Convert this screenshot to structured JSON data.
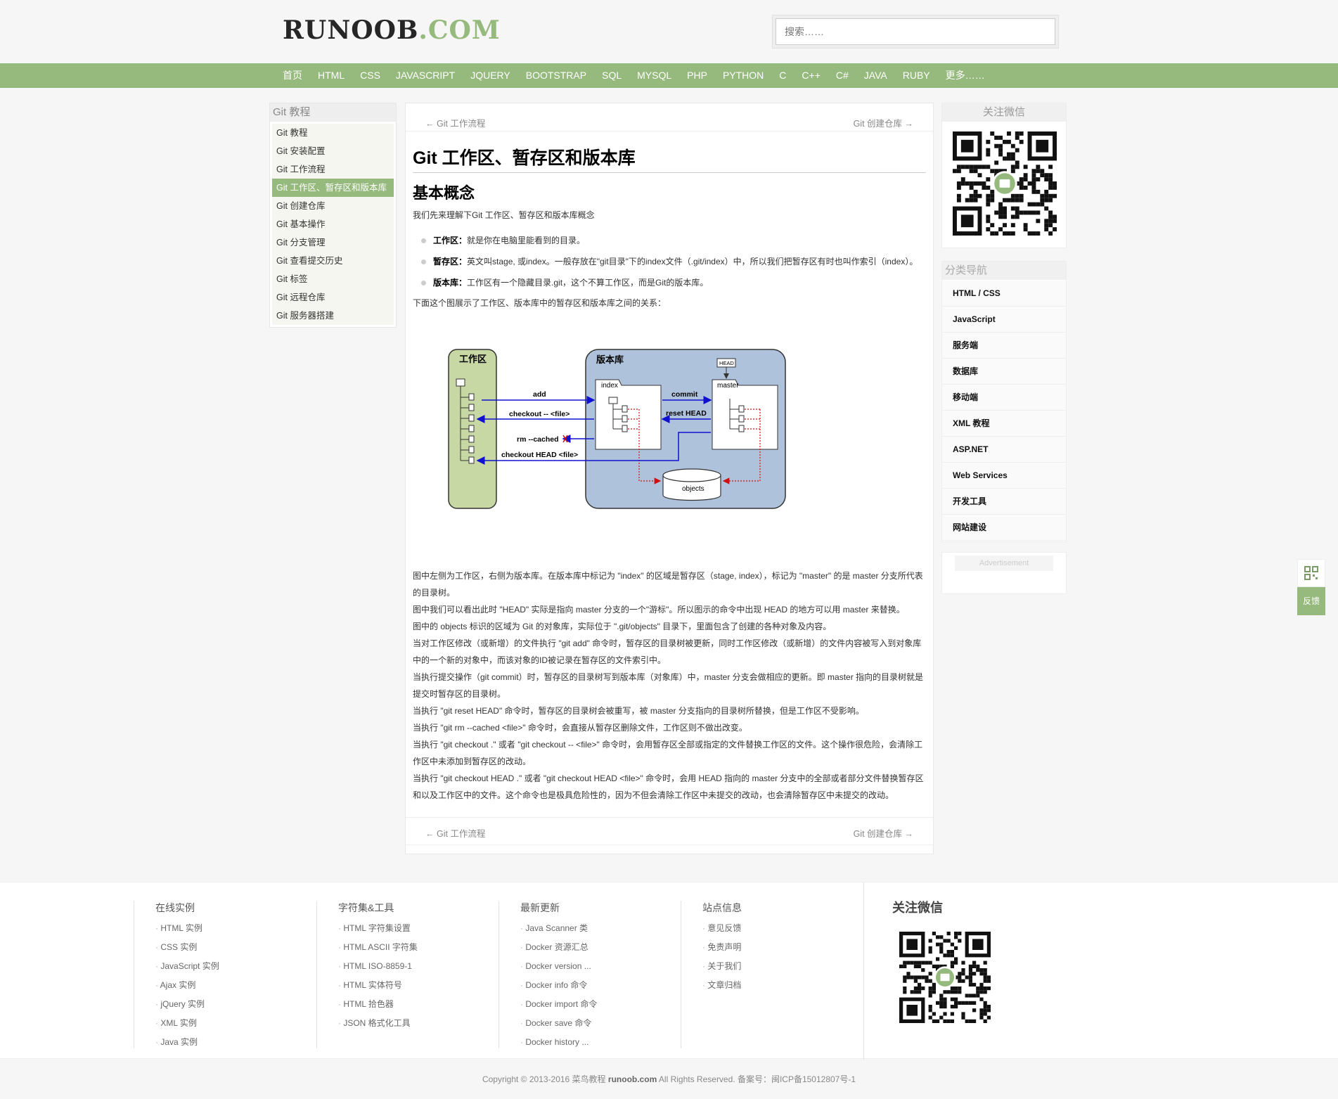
{
  "header": {
    "logo_main": "RUNOOB",
    "logo_dot": ".COM",
    "search_placeholder": "搜索……"
  },
  "nav": [
    "首页",
    "HTML",
    "CSS",
    "JAVASCRIPT",
    "JQUERY",
    "BOOTSTRAP",
    "SQL",
    "MYSQL",
    "PHP",
    "PYTHON",
    "C",
    "C++",
    "C#",
    "JAVA",
    "RUBY",
    "更多……"
  ],
  "left": {
    "title": "Git 教程",
    "items": [
      "Git 教程",
      "Git 安装配置",
      "Git 工作流程",
      "Git 工作区、暂存区和版本库",
      "Git 创建仓库",
      "Git 基本操作",
      "Git 分支管理",
      "Git 查看提交历史",
      "Git 标签",
      "Git 远程仓库",
      "Git 服务器搭建"
    ]
  },
  "main": {
    "prev": "← Git 工作流程",
    "next": "Git 创建仓库 →",
    "title": "Git 工作区、暂存区和版本库",
    "subtitle": "基本概念",
    "intro": "我们先来理解下Git 工作区、暂存区和版本库概念",
    "bullets": [
      {
        "term": "工作区：",
        "text": "就是你在电脑里能看到的目录。"
      },
      {
        "term": "暂存区：",
        "text": "英文叫stage, 或index。一般存放在\"git目录\"下的index文件（.git/index）中，所以我们把暂存区有时也叫作索引（index）。"
      },
      {
        "term": "版本库：",
        "text": "工作区有一个隐藏目录.git，这个不算工作区，而是Git的版本库。"
      }
    ],
    "diagram_desc": "下面这个图展示了工作区、版本库中的暂存区和版本库之间的关系：",
    "diagram": {
      "workspace": "工作区",
      "repo": "版本库",
      "index": "index",
      "master": "master",
      "head": "HEAD",
      "objects": "objects",
      "add": "add",
      "commit": "commit",
      "checkout_file": "checkout -- <file>",
      "reset_head": "reset HEAD",
      "rm_cached": "rm --cached",
      "checkout_head": "checkout HEAD <file>"
    },
    "paragraphs": [
      "图中左侧为工作区，右侧为版本库。在版本库中标记为 \"index\" 的区域是暂存区（stage, index），标记为 \"master\" 的是 master 分支所代表的目录树。",
      "图中我们可以看出此时 \"HEAD\" 实际是指向 master 分支的一个\"游标\"。所以图示的命令中出现 HEAD 的地方可以用 master 来替换。",
      "图中的 objects 标识的区域为 Git 的对象库，实际位于 \".git/objects\" 目录下，里面包含了创建的各种对象及内容。",
      "当对工作区修改（或新增）的文件执行 \"git add\" 命令时，暂存区的目录树被更新，同时工作区修改（或新增）的文件内容被写入到对象库中的一个新的对象中，而该对象的ID被记录在暂存区的文件索引中。",
      "当执行提交操作（git commit）时，暂存区的目录树写到版本库（对象库）中，master 分支会做相应的更新。即 master 指向的目录树就是提交时暂存区的目录树。",
      "当执行 \"git reset HEAD\" 命令时，暂存区的目录树会被重写，被 master 分支指向的目录树所替换，但是工作区不受影响。",
      "当执行 \"git rm --cached <file>\" 命令时，会直接从暂存区删除文件，工作区则不做出改变。",
      "当执行 \"git checkout .\" 或者 \"git checkout -- <file>\" 命令时，会用暂存区全部或指定的文件替换工作区的文件。这个操作很危险，会清除工作区中未添加到暂存区的改动。",
      "当执行 \"git checkout HEAD .\" 或者 \"git checkout HEAD <file>\" 命令时，会用 HEAD 指向的 master 分支中的全部或者部分文件替换暂存区和以及工作区中的文件。这个命令也是极具危险性的，因为不但会清除工作区中未提交的改动，也会清除暂存区中未提交的改动。"
    ]
  },
  "right": {
    "wechat_title": "关注微信",
    "cat_title": "分类导航",
    "cats": [
      "HTML / CSS",
      "JavaScript",
      "服务端",
      "数据库",
      "移动端",
      "XML 教程",
      "ASP.NET",
      "Web Services",
      "开发工具",
      "网站建设"
    ],
    "ad": "Advertisement"
  },
  "side": {
    "feedback": "反馈"
  },
  "footer": {
    "cols": [
      {
        "title": "在线实例",
        "items": [
          "HTML 实例",
          "CSS 实例",
          "JavaScript 实例",
          "Ajax 实例",
          "jQuery 实例",
          "XML 实例",
          "Java 实例"
        ]
      },
      {
        "title": "字符集&工具",
        "items": [
          "HTML 字符集设置",
          "HTML ASCII 字符集",
          "HTML ISO-8859-1",
          "HTML 实体符号",
          "HTML 拾色器",
          "JSON 格式化工具"
        ]
      },
      {
        "title": "最新更新",
        "items": [
          "Java Scanner 类",
          "Docker 资源汇总",
          "Docker version ...",
          "Docker info 命令",
          "Docker import 命令",
          "Docker save 命令",
          "Docker history ..."
        ]
      },
      {
        "title": "站点信息",
        "items": [
          "意见反馈",
          "免责声明",
          "关于我们",
          "文章归档"
        ]
      }
    ],
    "wechat": "关注微信",
    "copyright_pre": "Copyright © 2013-2016 菜鸟教程",
    "copyright_site": "runoob.com",
    "copyright_post": "All Rights Reserved. 备案号：闽ICP备15012807号-1"
  },
  "colors": {
    "accent": "#96b97d",
    "workspace_fill": "#c8d8a4",
    "repo_fill": "#afc2dc"
  }
}
